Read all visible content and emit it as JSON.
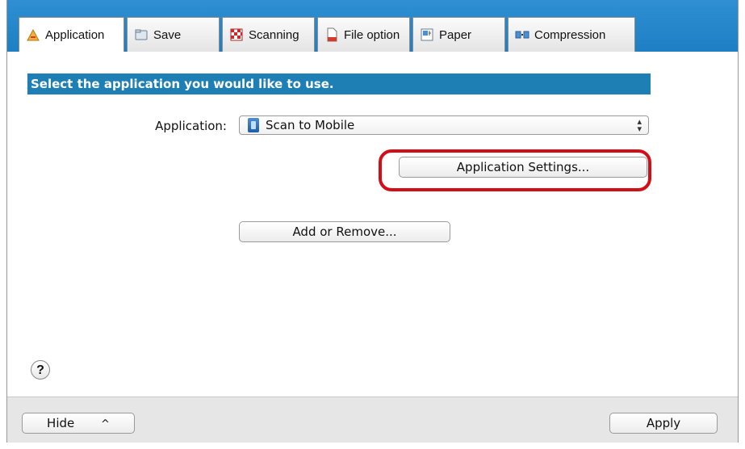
{
  "tabs": [
    {
      "label": "Application",
      "icon": "application-icon",
      "active": true
    },
    {
      "label": "Save",
      "icon": "save-folder-icon",
      "active": false
    },
    {
      "label": "Scanning",
      "icon": "scanning-icon",
      "active": false
    },
    {
      "label": "File option",
      "icon": "file-option-icon",
      "active": false
    },
    {
      "label": "Paper",
      "icon": "paper-icon",
      "active": false
    },
    {
      "label": "Compression",
      "icon": "compression-icon",
      "active": false
    }
  ],
  "main": {
    "banner": "Select the application you would like to use.",
    "application_label": "Application:",
    "application_value": "Scan to Mobile",
    "application_settings_button": "Application Settings...",
    "add_remove_button": "Add or Remove...",
    "help_button": "?"
  },
  "footer": {
    "hide_button": "Hide",
    "hide_chevron": "^",
    "apply_button": "Apply"
  },
  "colors": {
    "tabbar": "#1e7fc4",
    "banner": "#1e7fb4",
    "highlight": "#d40e17"
  }
}
